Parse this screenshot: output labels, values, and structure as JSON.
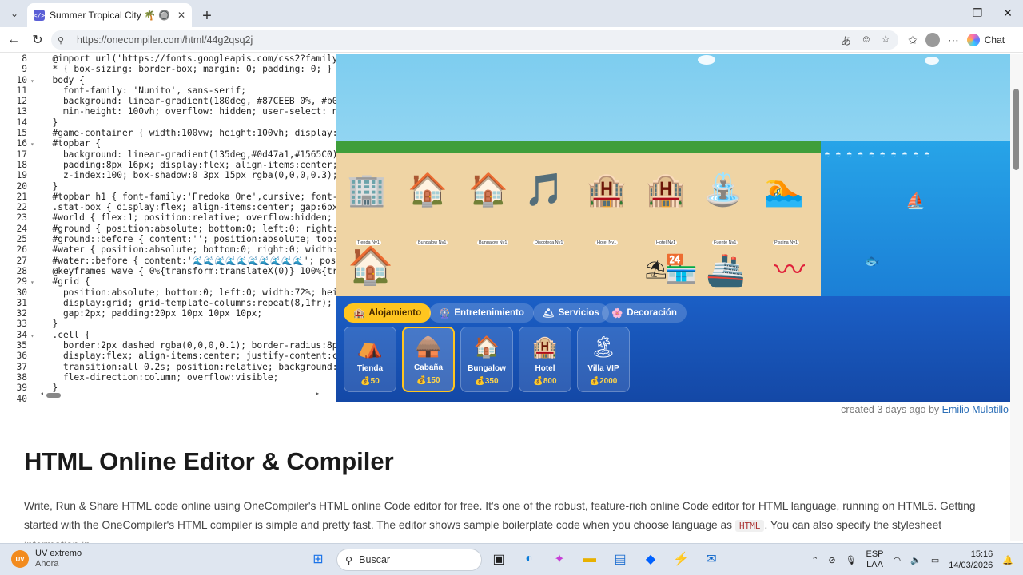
{
  "browser": {
    "tab_title": "Summer Tropical City 🌴 🔘 - HTM",
    "url": "https://onecompiler.com/html/44g2qsq2j",
    "chat_label": "Chat"
  },
  "editor": {
    "lines": [
      {
        "n": "8",
        "text": "  @import url('https://fonts.googleapis.com/css2?family="
      },
      {
        "n": "9",
        "text": "  * { box-sizing: border-box; margin: 0; padding: 0; }"
      },
      {
        "n": "10",
        "text": "  body {"
      },
      {
        "n": "11",
        "text": "    font-family: 'Nunito', sans-serif;"
      },
      {
        "n": "12",
        "text": "    background: linear-gradient(180deg, #87CEEB 0%, #b0"
      },
      {
        "n": "13",
        "text": "    min-height: 100vh; overflow: hidden; user-select: n"
      },
      {
        "n": "14",
        "text": "  }"
      },
      {
        "n": "15",
        "text": "  #game-container { width:100vw; height:100vh; display:"
      },
      {
        "n": "16",
        "text": "  #topbar {"
      },
      {
        "n": "17",
        "text": "    background: linear-gradient(135deg,#0d47a1,#1565C0);"
      },
      {
        "n": "18",
        "text": "    padding:8px 16px; display:flex; align-items:center;"
      },
      {
        "n": "19",
        "text": "    z-index:100; box-shadow:0 3px 15px rgba(0,0,0,0.3);"
      },
      {
        "n": "20",
        "text": "  }"
      },
      {
        "n": "21",
        "text": "  #topbar h1 { font-family:'Fredoka One',cursive; font-s"
      },
      {
        "n": "22",
        "text": "  .stat-box { display:flex; align-items:center; gap:6px"
      },
      {
        "n": "23",
        "text": "  #world { flex:1; position:relative; overflow:hidden;"
      },
      {
        "n": "24",
        "text": "  #ground { position:absolute; bottom:0; left:0; right:"
      },
      {
        "n": "25",
        "text": "  #ground::before { content:''; position:absolute; top:"
      },
      {
        "n": "26",
        "text": "  #water { position:absolute; bottom:0; right:0; width:"
      },
      {
        "n": "27",
        "text": "  #water::before { content:'🌊🌊🌊🌊🌊🌊🌊🌊🌊🌊'; posi"
      },
      {
        "n": "28",
        "text": "  @keyframes wave { 0%{transform:translateX(0)} 100%{tr"
      },
      {
        "n": "29",
        "text": "  #grid {"
      },
      {
        "n": "30",
        "text": "    position:absolute; bottom:0; left:0; width:72%; hei"
      },
      {
        "n": "31",
        "text": "    display:grid; grid-template-columns:repeat(8,1fr);"
      },
      {
        "n": "32",
        "text": "    gap:2px; padding:20px 10px 10px 10px;"
      },
      {
        "n": "33",
        "text": "  }"
      },
      {
        "n": "34",
        "text": "  .cell {"
      },
      {
        "n": "35",
        "text": "    border:2px dashed rgba(0,0,0,0.1); border-radius:8px"
      },
      {
        "n": "36",
        "text": "    display:flex; align-items:center; justify-content:c"
      },
      {
        "n": "37",
        "text": "    transition:all 0.2s; position:relative; background:"
      },
      {
        "n": "38",
        "text": "    flex-direction:column; overflow:visible;"
      },
      {
        "n": "39",
        "text": "  }"
      },
      {
        "n": "40",
        "text": ""
      }
    ]
  },
  "game": {
    "buildings": [
      {
        "icon": "🏢",
        "label": "Tienda Nv1"
      },
      {
        "icon": "🏠",
        "label": "Bungalow Nv1"
      },
      {
        "icon": "🏠",
        "label": "Bungalow Nv1"
      },
      {
        "icon": "🎵",
        "label": "Discoteca Nv1"
      },
      {
        "icon": "🏨",
        "label": "Hotel Nv1"
      },
      {
        "icon": "🏨",
        "label": "Hotel Nv1"
      },
      {
        "icon": "⛲",
        "label": "Fuente Nv1"
      },
      {
        "icon": "🏊",
        "label": "Piscina Nv1"
      }
    ],
    "categories": [
      {
        "icon": "🏨",
        "label": "Alojamiento",
        "active": true
      },
      {
        "icon": "🎡",
        "label": "Entretenimiento",
        "active": false
      },
      {
        "icon": "🛎",
        "label": "Servicios",
        "active": false
      },
      {
        "icon": "🌸",
        "label": "Decoración",
        "active": false
      }
    ],
    "cards": [
      {
        "icon": "⛺",
        "name": "Tienda",
        "price": "💰50",
        "selected": false
      },
      {
        "icon": "🛖",
        "name": "Cabaña",
        "price": "💰150",
        "selected": true
      },
      {
        "icon": "🏠",
        "name": "Bungalow",
        "price": "💰350",
        "selected": false
      },
      {
        "icon": "🏨",
        "name": "Hotel",
        "price": "💰800",
        "selected": false
      },
      {
        "icon": "🏝",
        "name": "Villa VIP",
        "price": "💰2000",
        "selected": false
      }
    ]
  },
  "page": {
    "created_text": "created 3 days ago by",
    "author": "Emilio Mulatillo",
    "heading": "HTML Online Editor & Compiler",
    "para_1": "Write, Run & Share HTML code online using OneCompiler's HTML online Code editor for free. It's one of the robust, feature-rich online Code editor for HTML language, running on HTML5. Getting started with the OneCompiler's HTML compiler is simple and pretty fast. The editor shows sample boilerplate code when you choose language as",
    "code_tag": "HTML",
    "para_2": ". You can also specify the stylesheet information in"
  },
  "taskbar": {
    "weather_title": "UV extremo",
    "weather_sub": "Ahora",
    "weather_badge": "UV",
    "search_placeholder": "Buscar",
    "lang_1": "ESP",
    "lang_2": "LAA",
    "time": "15:16",
    "date": "14/03/2026"
  }
}
